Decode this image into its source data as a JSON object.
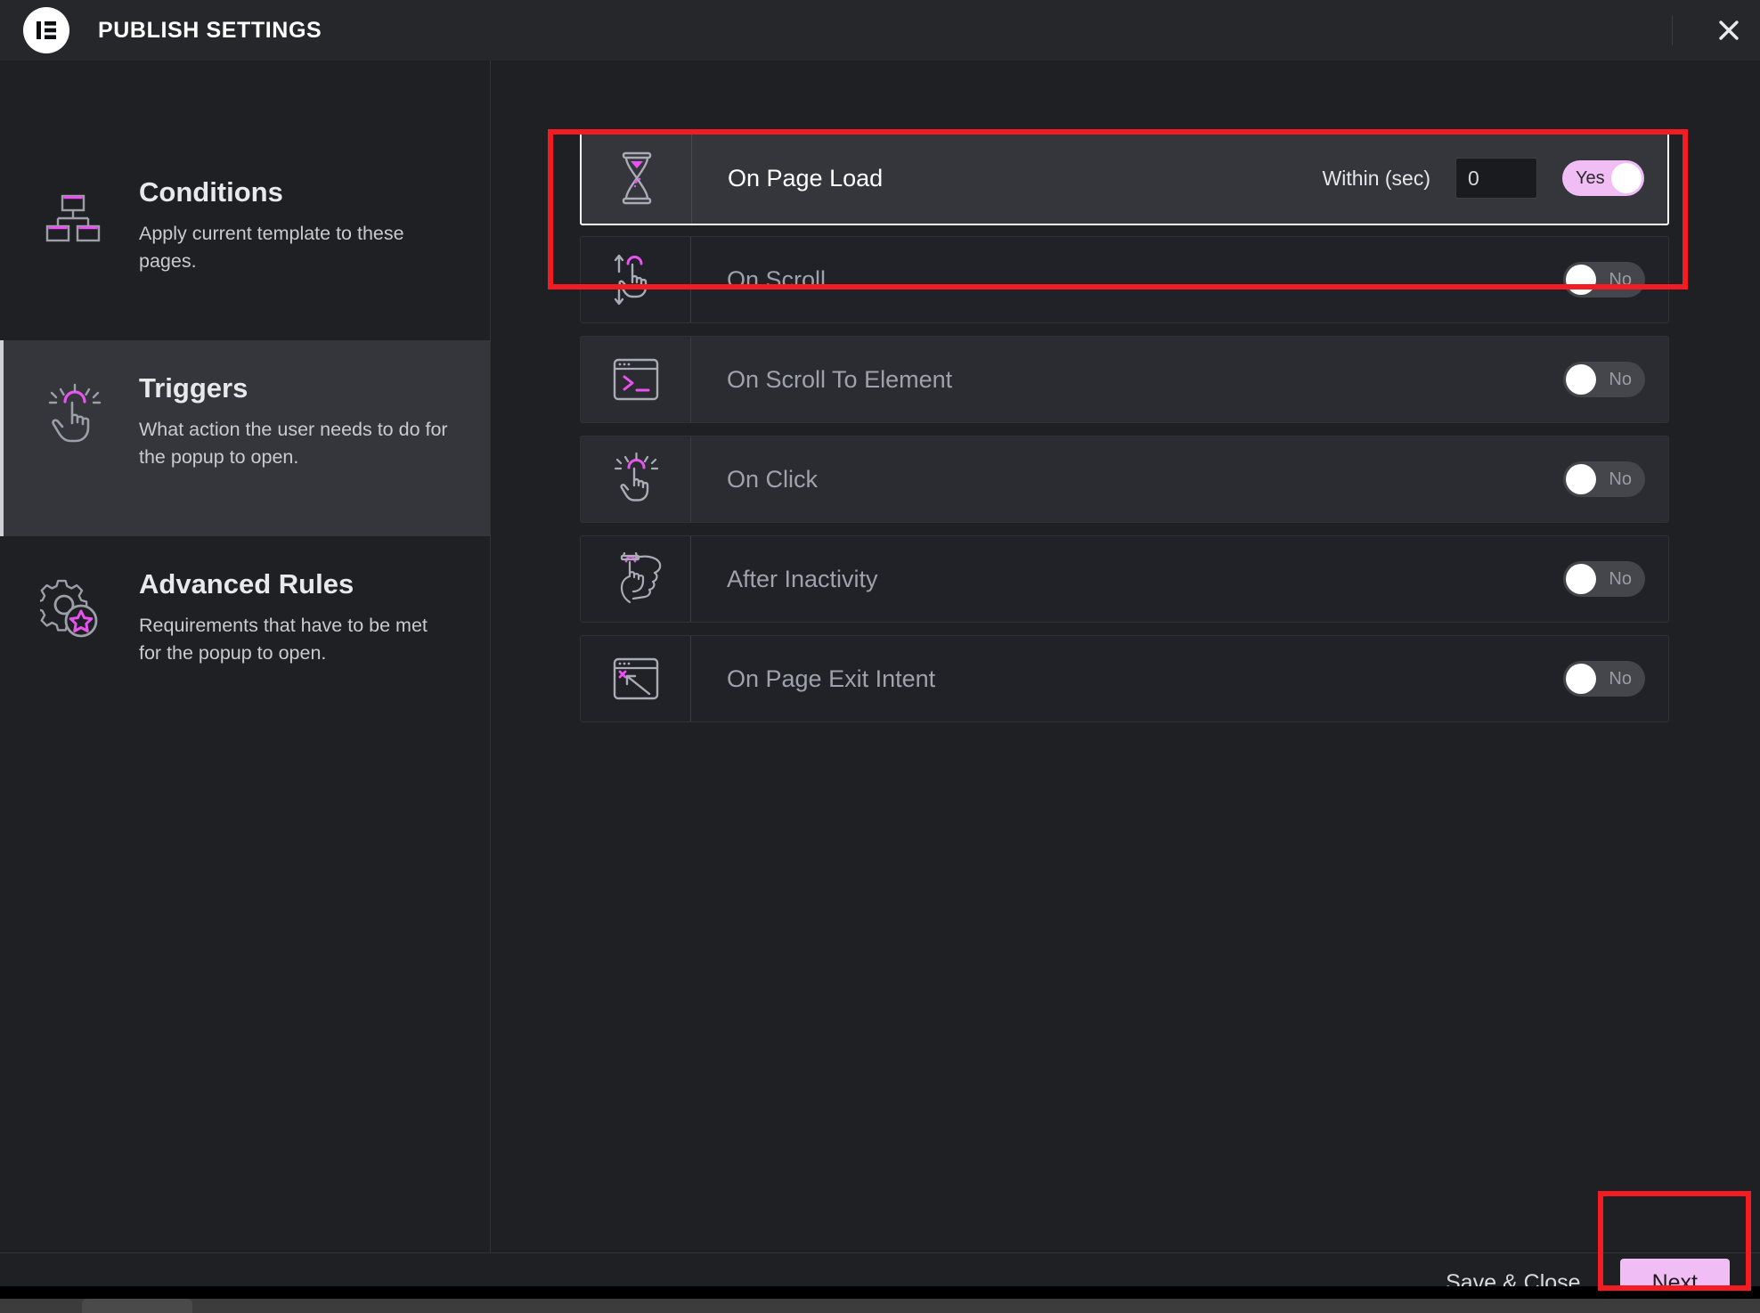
{
  "header": {
    "title": "PUBLISH SETTINGS",
    "logo_icon": "elementor-logo-icon",
    "close_icon": "close-icon"
  },
  "sidebar": {
    "items": [
      {
        "id": "conditions",
        "title": "Conditions",
        "description": "Apply current template to these pages.",
        "icon": "sitemap-icon",
        "active": false
      },
      {
        "id": "triggers",
        "title": "Triggers",
        "description": "What action the user needs to do for the popup to open.",
        "icon": "pointing-hand-click-icon",
        "active": true
      },
      {
        "id": "advanced-rules",
        "title": "Advanced Rules",
        "description": "Requirements that have to be met for the popup to open.",
        "icon": "gear-star-icon",
        "active": false
      }
    ]
  },
  "main": {
    "triggers": [
      {
        "id": "on-page-load",
        "label": "On Page Load",
        "icon": "hourglass-icon",
        "active": true,
        "toggle": {
          "state": "on",
          "label": "Yes"
        },
        "field": {
          "label": "Within (sec)",
          "value": "0",
          "placeholder": "0"
        }
      },
      {
        "id": "on-scroll",
        "label": "On Scroll",
        "icon": "scroll-hand-icon",
        "active": false,
        "toggle": {
          "state": "off",
          "label": "No"
        }
      },
      {
        "id": "on-scroll-to-element",
        "label": "On Scroll To Element",
        "icon": "browser-prompt-icon",
        "active": false,
        "toggle": {
          "state": "off",
          "label": "No"
        }
      },
      {
        "id": "on-click",
        "label": "On Click",
        "icon": "click-hand-icon",
        "active": false,
        "toggle": {
          "state": "off",
          "label": "No"
        }
      },
      {
        "id": "after-inactivity",
        "label": "After Inactivity",
        "icon": "hand-watch-icon",
        "active": false,
        "toggle": {
          "state": "off",
          "label": "No"
        }
      },
      {
        "id": "on-page-exit-intent",
        "label": "On Page Exit Intent",
        "icon": "browser-exit-arrow-icon",
        "active": false,
        "toggle": {
          "state": "off",
          "label": "No"
        }
      }
    ]
  },
  "footer": {
    "save_close_label": "Save & Close",
    "next_label": "Next"
  },
  "colors": {
    "accent_pink": "#f0bdf5",
    "icon_pink": "#e853f0",
    "annotation_red": "#f21c22",
    "panel_bg": "#1f2024",
    "header_bg": "#26272b",
    "active_row_bg": "#35363b"
  }
}
